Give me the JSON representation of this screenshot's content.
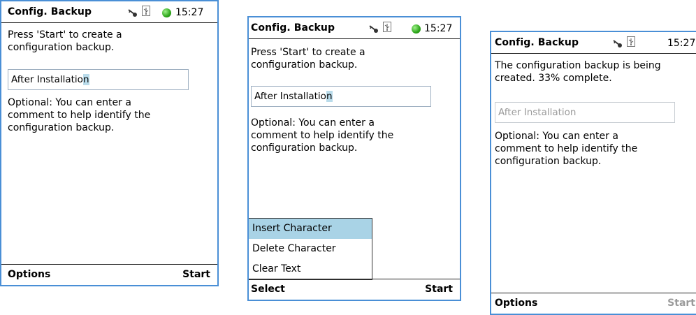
{
  "screens": [
    {
      "title": "Config. Backup",
      "time": "15:27",
      "message": "Press 'Start' to create a configuration backup.",
      "comment_text": "After Installatio",
      "comment_cursor": "n",
      "optional_text": "Optional: You can enter a comment to help identify the configuration backup.",
      "softkey_left": "Options",
      "softkey_right": "Start"
    },
    {
      "title": "Config. Backup",
      "time": "15:27",
      "message": "Press 'Start' to create a configuration backup.",
      "comment_text": "After Installatio",
      "comment_cursor": "n",
      "optional_text": "Optional: You can enter a comment to help identify the configuration backup.",
      "menu": [
        "Insert Character",
        "Delete Character",
        "Clear Text"
      ],
      "menu_selected": "Insert Character",
      "softkey_left": "Select",
      "softkey_right": "Start"
    },
    {
      "title": "Config. Backup",
      "time": "15:27",
      "message": "The configuration backup is being created. 33% complete.",
      "progress_percent": 33,
      "comment_text": "After Installation",
      "optional_text": "Optional: You can enter a comment to help identify the configuration backup.",
      "softkey_left": "Options",
      "softkey_right": "Start",
      "softkey_right_state": "disabled"
    }
  ],
  "icons": {
    "key": "key-icon",
    "usb": "usb-icon",
    "status_led": "status-led-icon",
    "status_led_color": "#2da61a"
  },
  "colors": {
    "frame_border": "#4a8fd6",
    "selection": "#a9d3e6",
    "disabled_text": "#9a9a9a"
  }
}
